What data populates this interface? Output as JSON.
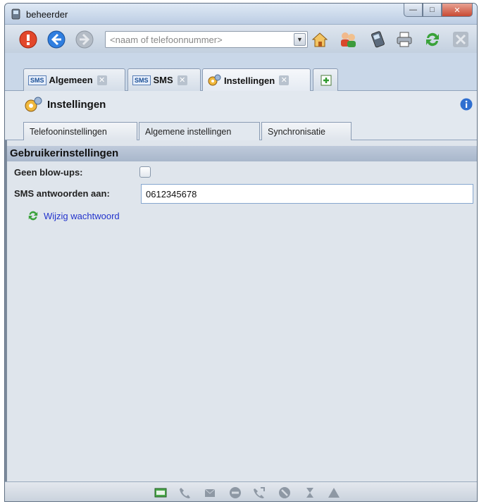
{
  "window": {
    "title": "beheerder"
  },
  "toolbar": {
    "search_placeholder": "<naam of telefoonnummer>"
  },
  "main_tabs": [
    {
      "label": "Algemeen",
      "badge": "SMS"
    },
    {
      "label": "SMS",
      "badge": "SMS"
    },
    {
      "label": "Instellingen"
    }
  ],
  "section": {
    "title": "Instellingen"
  },
  "sub_tabs": [
    {
      "label": "Telefooninstellingen"
    },
    {
      "label": "Algemene instellingen",
      "active": true
    },
    {
      "label": "Synchronisatie"
    }
  ],
  "settings": {
    "group_title": "Gebruikerinstellingen",
    "no_popups_label": "Geen blow-ups:",
    "sms_reply_label": "SMS antwoorden aan:",
    "sms_reply_value": "0612345678",
    "change_password_link": "Wijzig wachtwoord"
  },
  "colors": {
    "accent": "#c9d7e8",
    "link": "#2233cc",
    "content_bg": "#dfe5ec"
  }
}
